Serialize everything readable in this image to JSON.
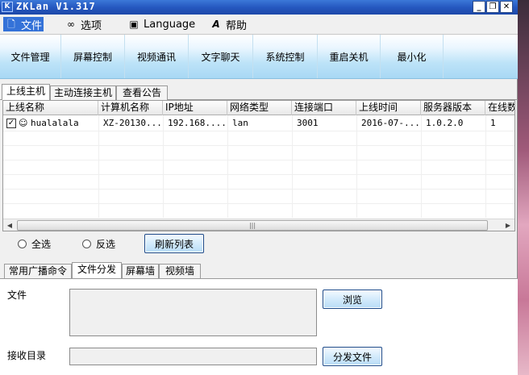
{
  "window": {
    "title": "ZKLan V1.317",
    "icon_letter": "K"
  },
  "window_buttons": {
    "minimize": "_",
    "restore": "❐",
    "close": "✕"
  },
  "menu": [
    {
      "label": "文件",
      "icon": "file-icon"
    },
    {
      "label": "选项",
      "icon": "glasses-icon"
    },
    {
      "label": "Language",
      "icon": "language-icon"
    },
    {
      "label": "帮助",
      "icon": "help-icon"
    }
  ],
  "toolbar": [
    "文件管理",
    "屏幕控制",
    "视频通讯",
    "文字聊天",
    "系统控制",
    "重启关机",
    "最小化"
  ],
  "host_tabs": [
    "上线主机",
    "主动连接主机",
    "查看公告"
  ],
  "table": {
    "columns": [
      "上线名称",
      "计算机名称",
      "IP地址",
      "网络类型",
      "连接端口",
      "上线时间",
      "服务器版本",
      "在线数"
    ],
    "rows": [
      {
        "checked": true,
        "name": "hualalala",
        "computer": "XZ-20130...",
        "ip": "192.168....",
        "net": "lan",
        "port": "3001",
        "time": "2016-07-...",
        "version": "1.0.2.0",
        "online": "1"
      }
    ]
  },
  "radios": [
    "全选",
    "反选"
  ],
  "refresh_button": "刷新列表",
  "lower_tabs": [
    "常用广播命令",
    "文件分发",
    "屏幕墙",
    "视频墙"
  ],
  "file_panel": {
    "file_label": "文件",
    "browse_button": "浏览",
    "dir_label": "接收目录",
    "send_button": "分发文件"
  }
}
